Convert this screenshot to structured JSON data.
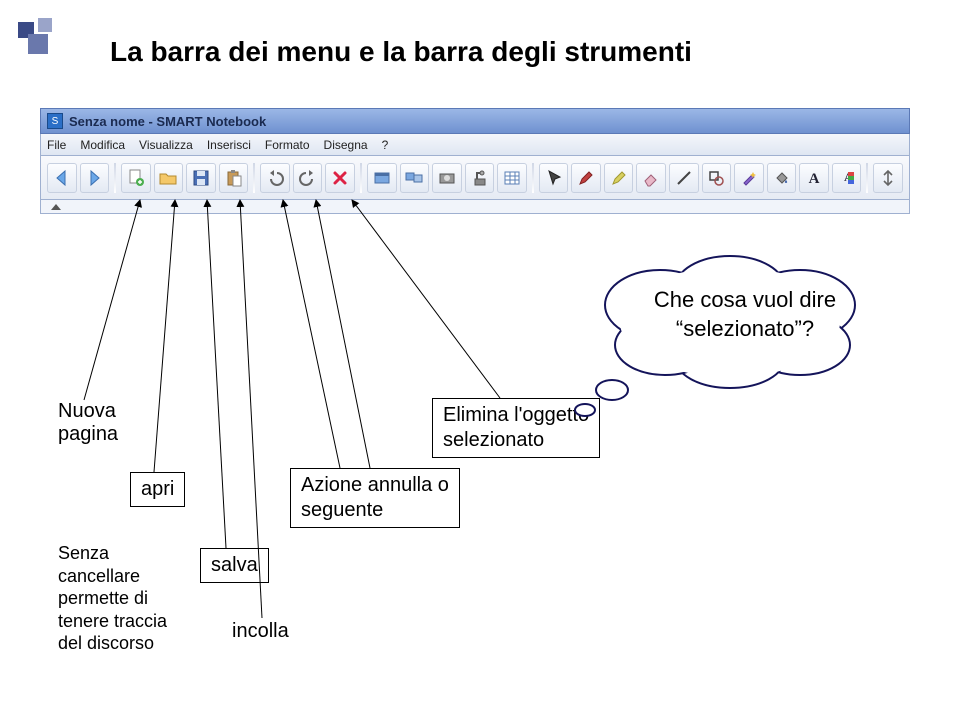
{
  "title": "La barra dei menu e la barra degli strumenti",
  "window": {
    "app_icon_glyph": "S",
    "app_title": "Senza nome - SMART Notebook",
    "menus": [
      "File",
      "Modifica",
      "Visualizza",
      "Inserisci",
      "Formato",
      "Disegna",
      "?"
    ]
  },
  "toolbar_icons": [
    "arrow-left-icon",
    "arrow-right-icon",
    "new-page-icon",
    "open-icon",
    "save-icon",
    "paste-icon",
    "undo-icon",
    "redo-icon",
    "delete-icon",
    "fullscreen-icon",
    "dual-monitor-icon",
    "capture-icon",
    "doc-camera-icon",
    "table-icon",
    "pointer-icon",
    "pen-icon",
    "highlighter-icon",
    "eraser-icon",
    "line-icon",
    "shape-icon",
    "magic-pen-icon",
    "fill-icon",
    "text-icon",
    "color-props-icon",
    "move-toolbar-icon"
  ],
  "annotations": {
    "nuova_pagina": "Nuova\npagina",
    "apri": "apri",
    "salva": "salva",
    "incolla": "incolla",
    "senza_cancellare": "Senza\ncancellare\npermette di\ntenere traccia\ndel discorso",
    "azione": "Azione annulla o\nseguente",
    "elimina": "Elimina l'oggetto\nselezionato",
    "cloud": "Che cosa vuol dire\n“selezionato”?"
  }
}
